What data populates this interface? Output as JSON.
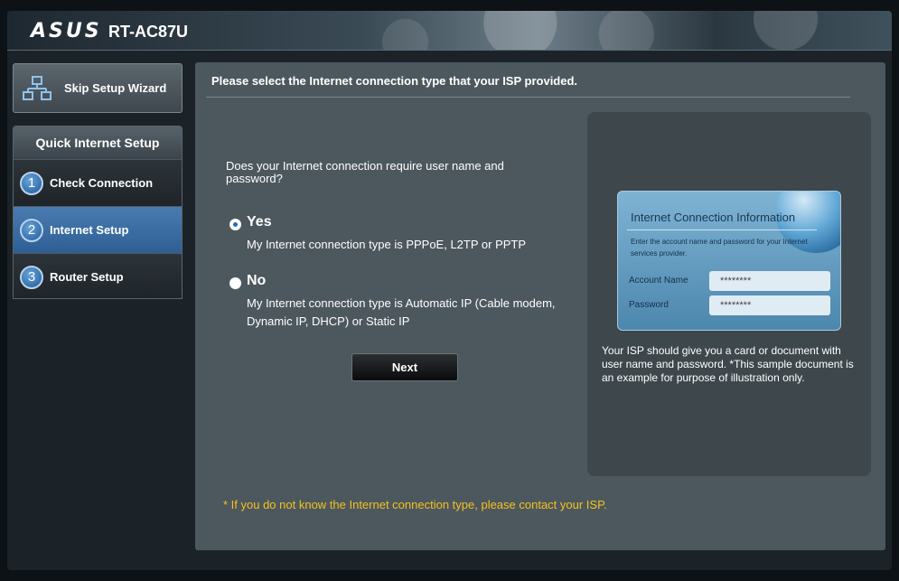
{
  "header": {
    "brand": "ASUS",
    "model": "RT-AC87U"
  },
  "sidebar": {
    "skip_label": "Skip Setup Wizard",
    "section_title": "Quick Internet Setup",
    "steps": [
      {
        "num": "1",
        "label": "Check Connection",
        "active": false
      },
      {
        "num": "2",
        "label": "Internet Setup",
        "active": true
      },
      {
        "num": "3",
        "label": "Router Setup",
        "active": false
      }
    ]
  },
  "main": {
    "title": "Please select the Internet connection type that your ISP provided.",
    "question": "Does your Internet connection require user name and password?",
    "options": [
      {
        "title": "Yes",
        "desc": "My Internet connection type is PPPoE, L2TP or PPTP",
        "selected": true
      },
      {
        "title": "No",
        "desc": "My Internet connection type is Automatic IP (Cable modem, Dynamic IP, DHCP) or Static IP",
        "selected": false
      }
    ],
    "next_label": "Next",
    "footnote": "* If you do not know the Internet connection type, please contact your ISP."
  },
  "illustration": {
    "card_title": "Internet Connection Information",
    "card_desc": "Enter the account name and password for your Internet services provider.",
    "account_label": "Account Name",
    "account_value": "********",
    "password_label": "Password",
    "password_value": "********",
    "note": "Your ISP should give you a card or document with user name and password. *This sample document is an example for purpose of illustration only."
  },
  "colors": {
    "accent": "#2d5f95",
    "footnote": "#f2c21e",
    "panel": "#4d585e"
  }
}
